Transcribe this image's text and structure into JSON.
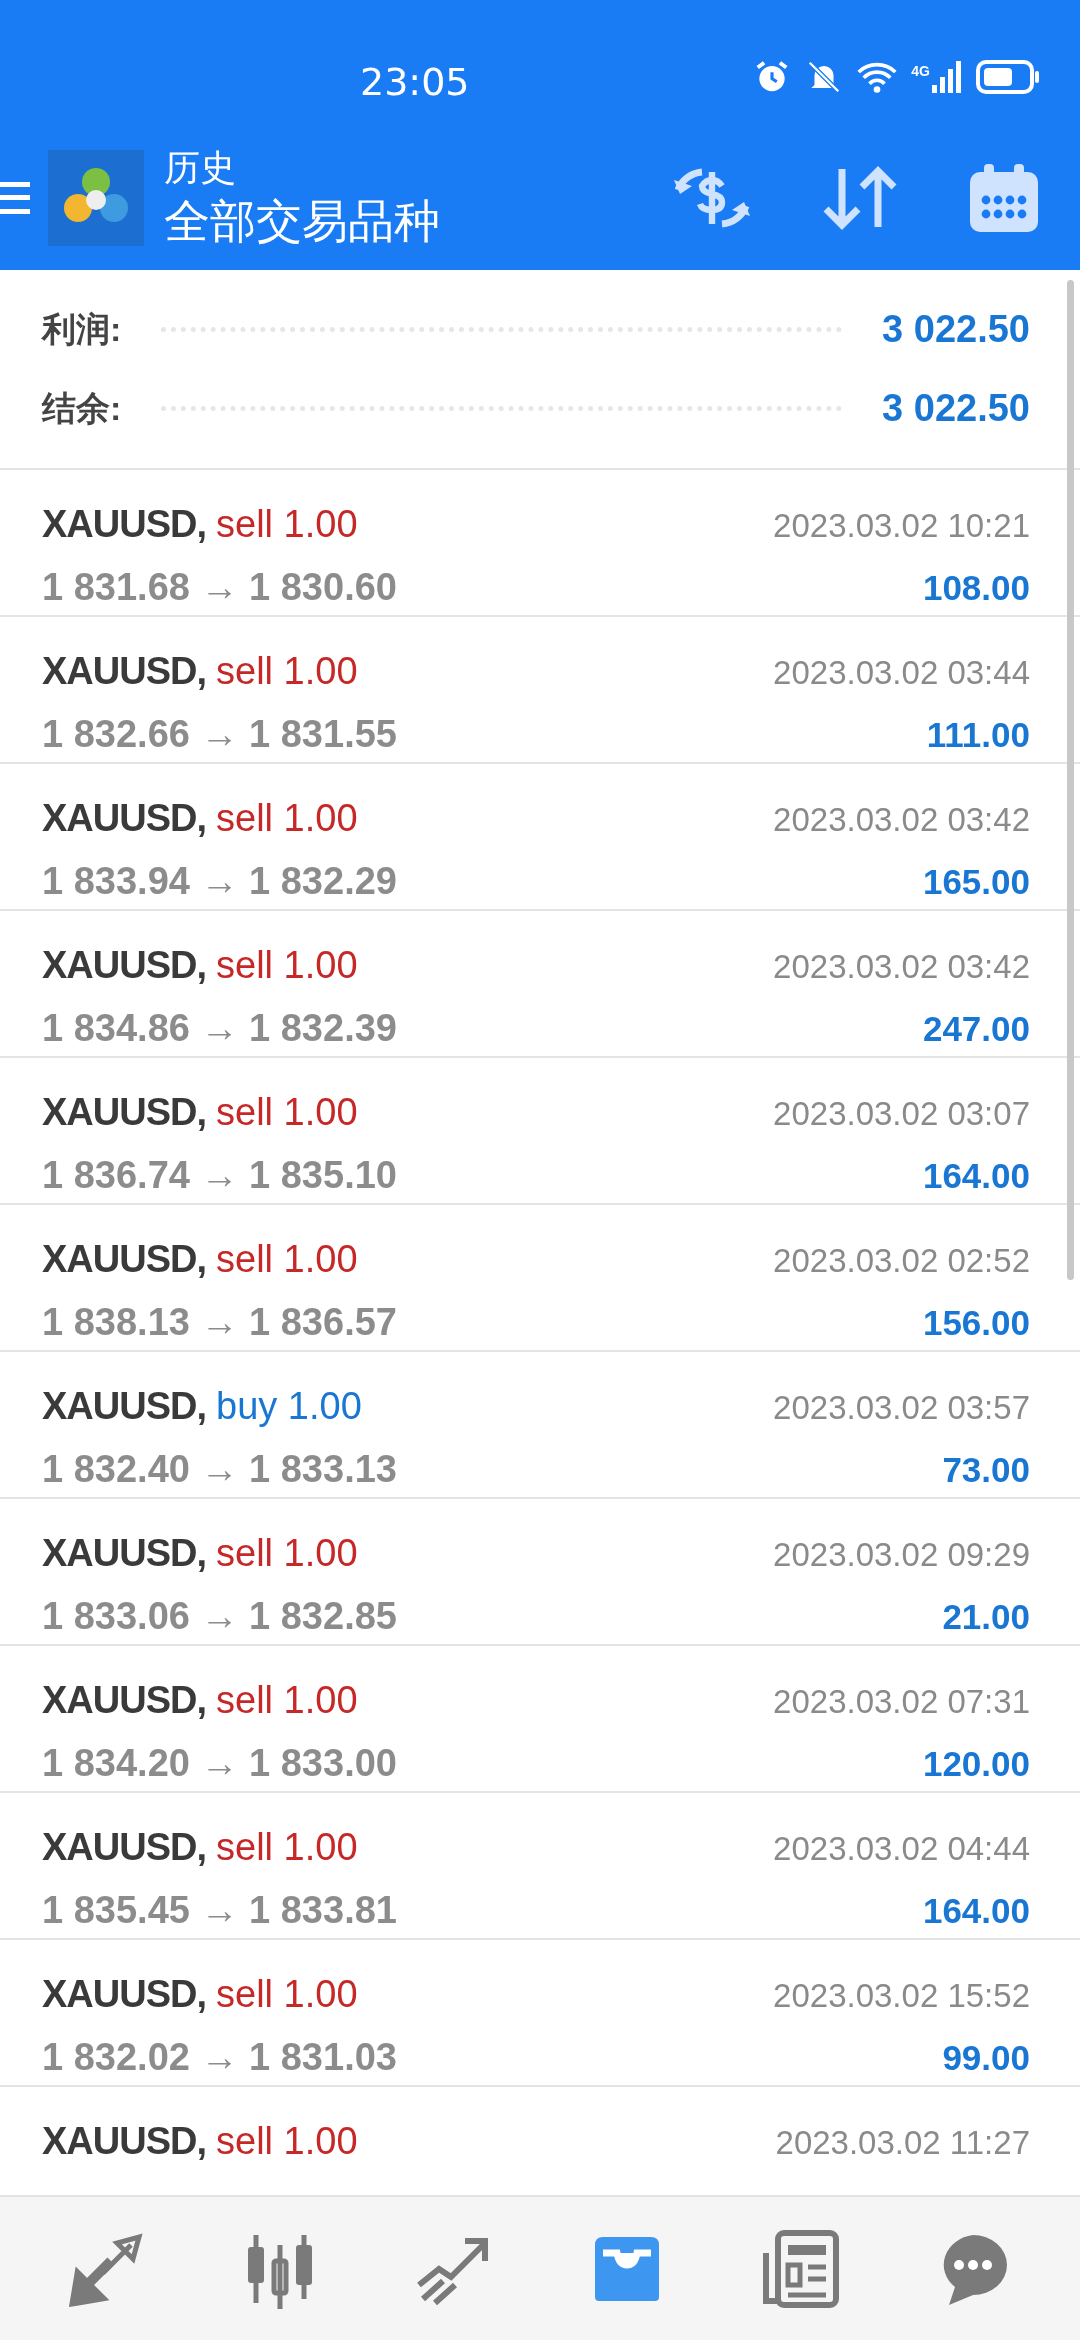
{
  "status_bar": {
    "time": "23:05",
    "network": "4G"
  },
  "header": {
    "title": "历史",
    "subtitle": "全部交易品种"
  },
  "summary": [
    {
      "label": "利润:",
      "value": "3 022.50"
    },
    {
      "label": "结余:",
      "value": "3 022.50"
    }
  ],
  "trades": [
    {
      "symbol": "XAUUSD,",
      "order": "sell 1.00",
      "is_buy": false,
      "time": "2023.03.02 10:21",
      "prices": "1 831.68 → 1 830.60",
      "profit": "108.00"
    },
    {
      "symbol": "XAUUSD,",
      "order": "sell 1.00",
      "is_buy": false,
      "time": "2023.03.02 03:44",
      "prices": "1 832.66 → 1 831.55",
      "profit": "111.00"
    },
    {
      "symbol": "XAUUSD,",
      "order": "sell 1.00",
      "is_buy": false,
      "time": "2023.03.02 03:42",
      "prices": "1 833.94 → 1 832.29",
      "profit": "165.00"
    },
    {
      "symbol": "XAUUSD,",
      "order": "sell 1.00",
      "is_buy": false,
      "time": "2023.03.02 03:42",
      "prices": "1 834.86 → 1 832.39",
      "profit": "247.00"
    },
    {
      "symbol": "XAUUSD,",
      "order": "sell 1.00",
      "is_buy": false,
      "time": "2023.03.02 03:07",
      "prices": "1 836.74 → 1 835.10",
      "profit": "164.00"
    },
    {
      "symbol": "XAUUSD,",
      "order": "sell 1.00",
      "is_buy": false,
      "time": "2023.03.02 02:52",
      "prices": "1 838.13 → 1 836.57",
      "profit": "156.00"
    },
    {
      "symbol": "XAUUSD,",
      "order": "buy 1.00",
      "is_buy": true,
      "time": "2023.03.02 03:57",
      "prices": "1 832.40 → 1 833.13",
      "profit": "73.00"
    },
    {
      "symbol": "XAUUSD,",
      "order": "sell 1.00",
      "is_buy": false,
      "time": "2023.03.02 09:29",
      "prices": "1 833.06 → 1 832.85",
      "profit": "21.00"
    },
    {
      "symbol": "XAUUSD,",
      "order": "sell 1.00",
      "is_buy": false,
      "time": "2023.03.02 07:31",
      "prices": "1 834.20 → 1 833.00",
      "profit": "120.00"
    },
    {
      "symbol": "XAUUSD,",
      "order": "sell 1.00",
      "is_buy": false,
      "time": "2023.03.02 04:44",
      "prices": "1 835.45 → 1 833.81",
      "profit": "164.00"
    },
    {
      "symbol": "XAUUSD,",
      "order": "sell 1.00",
      "is_buy": false,
      "time": "2023.03.02 15:52",
      "prices": "1 832.02 → 1 831.03",
      "profit": "99.00"
    },
    {
      "symbol": "XAUUSD,",
      "order": "sell 1.00",
      "is_buy": false,
      "time": "2023.03.02 11:27"
    }
  ],
  "bottom_nav": [
    {
      "kind": "quotes",
      "selected": false
    },
    {
      "kind": "chart",
      "selected": false
    },
    {
      "kind": "trade",
      "selected": false
    },
    {
      "kind": "history",
      "selected": true
    },
    {
      "kind": "news",
      "selected": false
    },
    {
      "kind": "chat",
      "selected": false
    }
  ]
}
